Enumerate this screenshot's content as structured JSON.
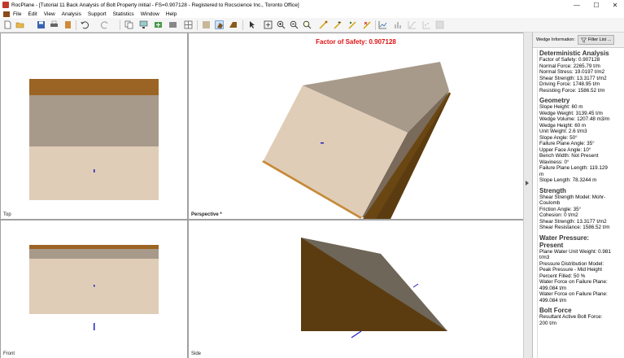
{
  "window": {
    "title": "RocPlane - [Tutorial 11 Back Analysis of Bolt Property initial - FS=0.907128 - Registered to Rocscience Inc., Toronto Office]",
    "minimize": "—",
    "maximize": "☐",
    "close": "✕"
  },
  "menu": [
    "File",
    "Edit",
    "View",
    "Analysis",
    "Support",
    "Statistics",
    "Window",
    "Help"
  ],
  "views": {
    "top_label": "Top",
    "perspective_label": "Perspective *",
    "front_label": "Front",
    "side_label": "Side",
    "factor_of_safety": "Factor of Safety: 0.907128"
  },
  "colors": {
    "face": "#e0cdb7",
    "slope_face": "#a89a8a",
    "upper": "#9c6424",
    "dark": "#5b3c10",
    "fos": "#e01010"
  },
  "panel": {
    "title": "Wedge Information:",
    "filter_button": "Filter List ...",
    "sections": [
      {
        "title": "Deterministic Analysis",
        "lines": [
          "Factor of Safety: 0.907128",
          "Normal Force: 2265.79 t/m",
          "Normal Stress: 19.0197 t/m2",
          "Shear Strength: 13.3177 t/m2",
          "Driving Force: 1748.95 t/m",
          "Resisting Force: 1586.52 t/m"
        ]
      },
      {
        "title": "Geometry",
        "lines": [
          "Slope Height: 60 m",
          "Wedge Weight: 3139.45 t/m",
          "Wedge Volume: 1207.48 m3/m",
          "Wedge Height: 60 m",
          "Unit Weight: 2.6 t/m3",
          "Slope Angle: 50°",
          "Failure Plane Angle: 35°",
          "Upper Face Angle: 10°",
          "Bench Width: Not Present",
          "Waviness: 0°",
          "Failure Plane Length: 119.129",
          "m",
          "Slope Length: 78.3244 m"
        ]
      },
      {
        "title": "Strength",
        "lines": [
          "Shear Strength Model: Mohr-",
          "Coulomb",
          "Friction Angle: 35°",
          "Cohesion: 0 t/m2",
          "Shear Strength: 13.3177 t/m2",
          "Shear Resistance: 1586.52 t/m"
        ]
      },
      {
        "title": "Water Pressure:",
        "title2": "Present",
        "lines": [
          "Plane Water Unit Weight: 0.981",
          "t/m3",
          "Pressure Distribution Model:",
          "Peak Pressure - Mid Height",
          "Percent Filled: 50 %",
          "Water Force on Failure Plane:",
          "499.084 t/m",
          "Water Force on Failure Plane:",
          "499.084 t/m"
        ]
      },
      {
        "title": "Bolt Force",
        "lines": [
          "Resultant Active Bolt Force:",
          "200 t/m"
        ]
      }
    ]
  }
}
